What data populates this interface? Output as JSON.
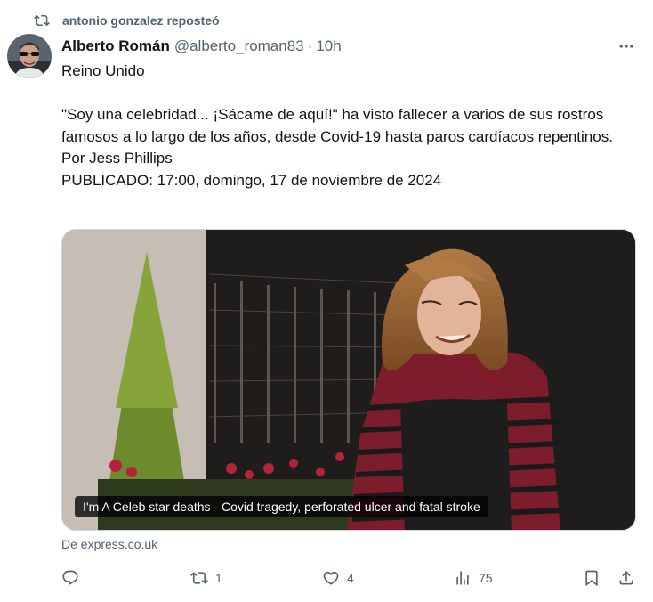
{
  "repost": {
    "label": "antonio gonzalez reposteó",
    "icon": "repost-icon"
  },
  "author": {
    "name": "Alberto Román",
    "handle": "@alberto_roman83",
    "separator": "·",
    "time": "10h"
  },
  "tweet": {
    "line1": "Reino Unido",
    "line2": "\"Soy una celebridad... ¡Sácame de aquí!\" ha visto fallecer a varios de sus rostros famosos a lo largo de los años, desde Covid-19 hasta paros cardíacos repentinos.",
    "line3": "Por Jess Phillips",
    "line4": "PUBLICADO: 17:00, domingo, 17 de noviembre de 2024"
  },
  "card": {
    "caption": "I'm A Celeb star deaths - Covid tragedy, perforated ulcer and fatal stroke",
    "source": "De express.co.uk"
  },
  "actions": {
    "reply": {
      "icon": "reply-icon",
      "count": ""
    },
    "repost": {
      "icon": "repost-icon",
      "count": "1"
    },
    "like": {
      "icon": "heart-icon",
      "count": "4"
    },
    "views": {
      "icon": "views-icon",
      "count": "75"
    },
    "bookmark": {
      "icon": "bookmark-icon"
    },
    "share": {
      "icon": "share-icon"
    }
  },
  "colors": {
    "text": "#0f1419",
    "secondary": "#536471",
    "border": "#cfd9de"
  }
}
